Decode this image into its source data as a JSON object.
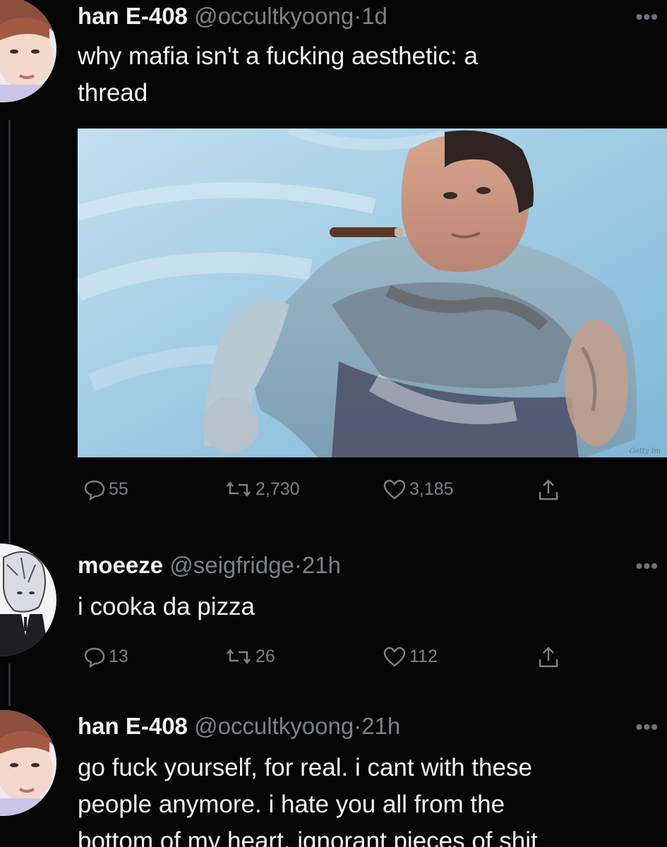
{
  "tweets": [
    {
      "name": "han E-408",
      "handle": "@occultkyoong",
      "time": "1d",
      "text_lines": [
        "why mafia isn't a fucking aesthetic: a",
        "thread"
      ],
      "media": {
        "description": "man in swimming pool with cigar",
        "credit": "Getty Im"
      },
      "replies": "55",
      "retweets": "2,730",
      "likes": "3,185"
    },
    {
      "name": "moeeze",
      "handle": "@seigfridge",
      "time": "21h",
      "text_lines": [
        "i cooka da pizza"
      ],
      "replies": "13",
      "retweets": "26",
      "likes": "112"
    },
    {
      "name": "han E-408",
      "handle": "@occultkyoong",
      "time": "21h",
      "text_lines": [
        "go fuck yourself, for real. i cant with these",
        "people anymore. i hate you all from the",
        "bottom of my heart, ignorant pieces of shit"
      ]
    }
  ],
  "separator": "·",
  "more_glyph": "•••",
  "icons": [
    "reply-icon",
    "retweet-icon",
    "like-icon",
    "share-icon",
    "more-icon"
  ],
  "colors": {
    "background": "#050506",
    "muted": "#7d8186",
    "text": "#f4f4f5",
    "pool": "#a9cfe4"
  }
}
